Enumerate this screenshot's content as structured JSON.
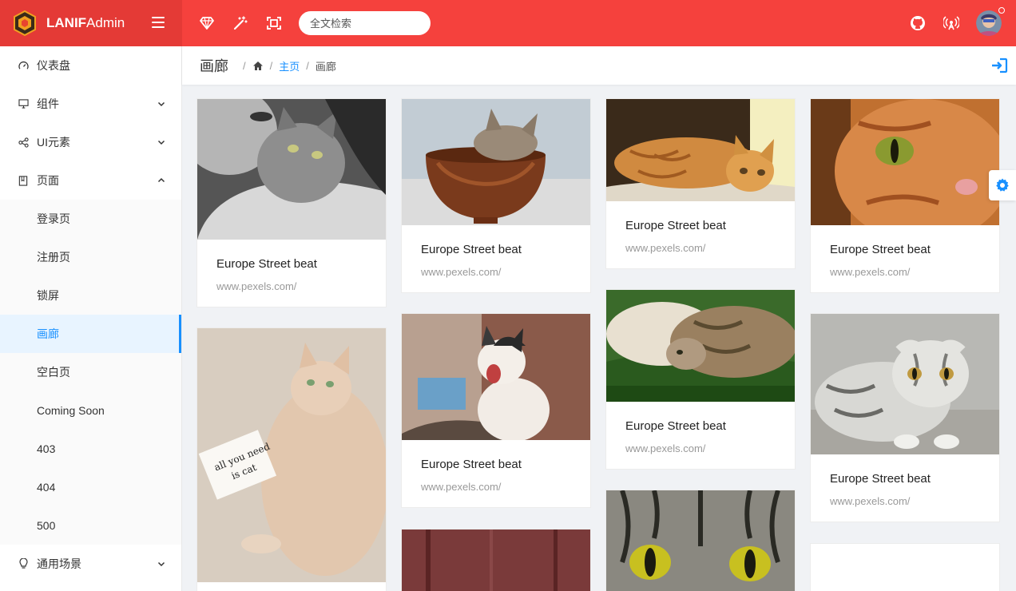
{
  "header": {
    "brand_bold": "LANIF",
    "brand_rest": "Admin",
    "search_placeholder": "全文检索",
    "icons": [
      "diamond-icon",
      "magic-wand-icon",
      "fullscreen-icon",
      "github-icon",
      "broadcast-icon"
    ]
  },
  "sidebar": {
    "items": [
      {
        "label": "仪表盘",
        "icon": "dashboard-icon"
      },
      {
        "label": "组件",
        "icon": "monitor-icon"
      },
      {
        "label": "UI元素",
        "icon": "share-icon"
      },
      {
        "label": "页面",
        "icon": "book-icon"
      }
    ],
    "sub_items": [
      "登录页",
      "注册页",
      "锁屏",
      "画廊",
      "空白页",
      "Coming Soon",
      "403",
      "404",
      "500"
    ],
    "last_item": {
      "label": "通用场景",
      "icon": "bulb-icon"
    }
  },
  "breadcrumb": {
    "title": "画廊",
    "home_link": "主页",
    "current": "画廊"
  },
  "gallery": {
    "cards": [
      {
        "title": "Europe Street beat",
        "subtitle": "www.pexels.com/"
      },
      {
        "title": "Europe Street beat",
        "subtitle": "www.pexels.com/"
      },
      {
        "title": "Europe Street beat",
        "subtitle": "www.pexels.com/"
      },
      {
        "title": "Europe Street beat",
        "subtitle": "www.pexels.com/"
      },
      {
        "title": "Europe Street beat",
        "subtitle": "www.pexels.com/"
      },
      {
        "title": "Europe Street beat",
        "subtitle": "www.pexels.com/"
      },
      {
        "title": "Europe Street beat",
        "subtitle": "www.pexels.com/"
      }
    ]
  },
  "colors": {
    "header": "#f5413d",
    "brand": "#e43a36",
    "accent": "#1890ff"
  }
}
